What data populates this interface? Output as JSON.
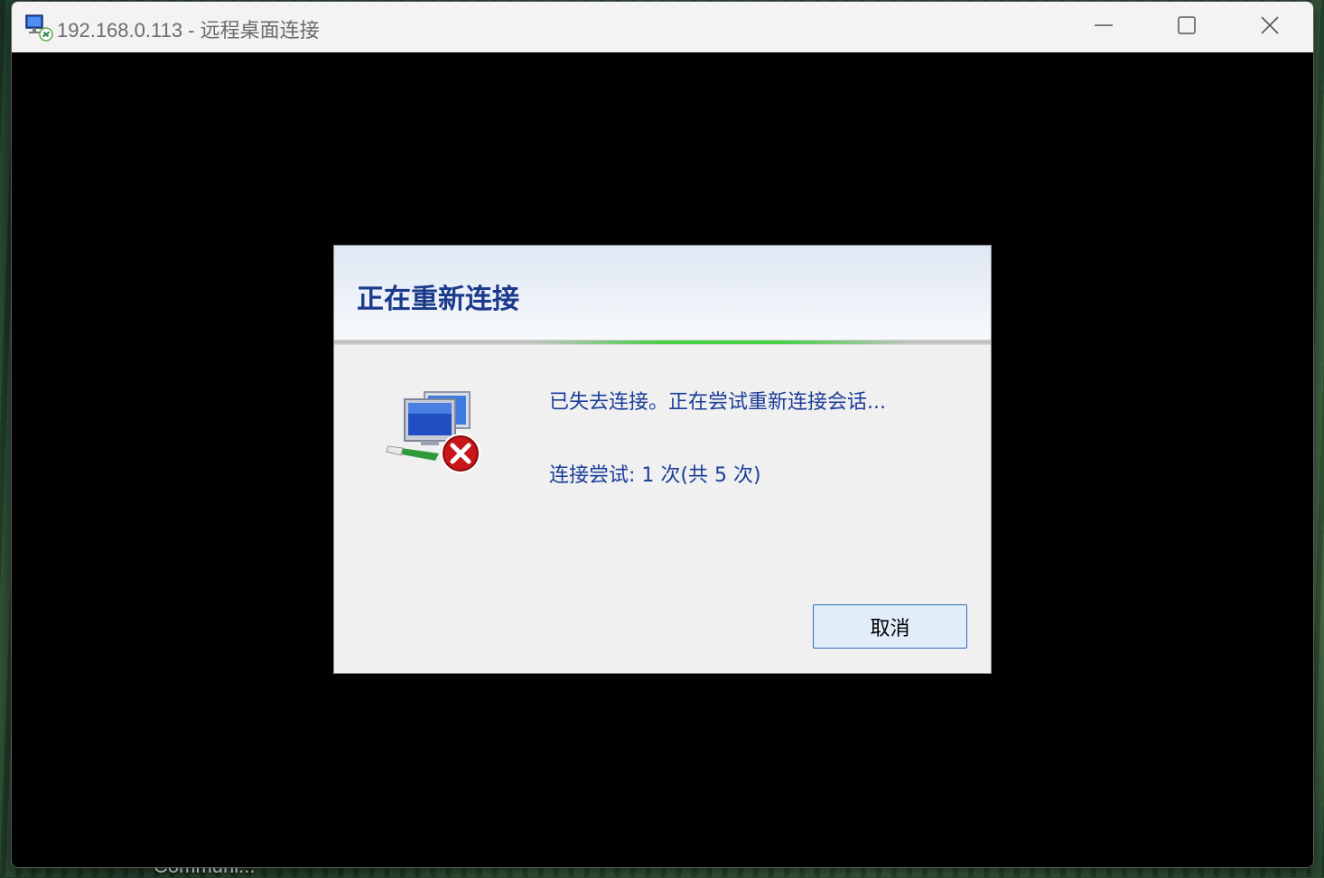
{
  "background": {
    "partial_label": "Communi..."
  },
  "window": {
    "title": "192.168.0.113 - 远程桌面连接",
    "icon": "remote-desktop-icon",
    "controls": {
      "minimize": "minimize-icon",
      "maximize": "maximize-icon",
      "close": "close-icon"
    }
  },
  "dialog": {
    "title": "正在重新连接",
    "icon": "network-disconnected-error-icon",
    "message": "已失去连接。正在尝试重新连接会话...",
    "attempts": "连接尝试: 1 次(共 5 次)",
    "cancel_label": "取消"
  },
  "colors": {
    "dialog_title": "#1b3a8c",
    "dialog_text": "#1a3d99",
    "progress_accent": "#3cd23c",
    "button_border": "#2f6fb8",
    "button_bg": "#e1edf9"
  }
}
